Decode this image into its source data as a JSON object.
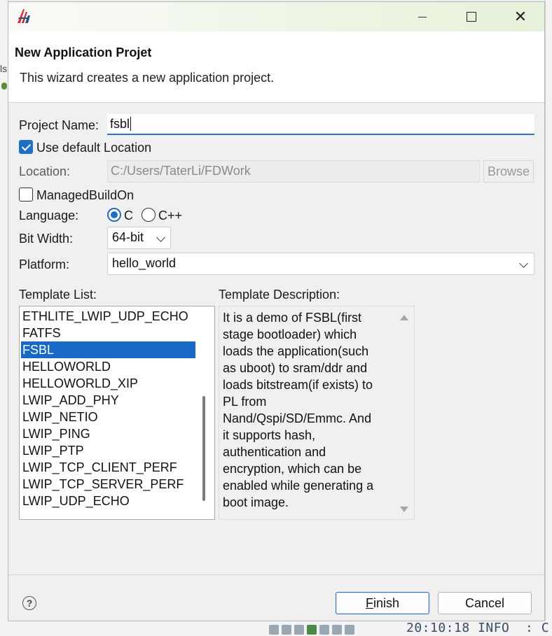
{
  "background": {
    "left_fragment": "ls",
    "log_text": "20:10:18 INFO  : C"
  },
  "dialog": {
    "title": "New Application Projet",
    "description": "This wizard creates a new application project.",
    "close_glyph": "✕"
  },
  "form": {
    "project_name_label": "Project Name:",
    "project_name_value": "fsbl",
    "use_default_location_label": "Use default Location",
    "use_default_location_checked": true,
    "location_label": "Location:",
    "location_value": "C:/Users/TaterLi/FDWork",
    "browse_label": "Browse",
    "managed_build_label": "ManagedBuildOn",
    "managed_build_checked": false,
    "language_label": "Language:",
    "language_options": [
      "C",
      "C++"
    ],
    "language_selected": "C",
    "bit_width_label": "Bit Width:",
    "bit_width_value": "64-bit",
    "platform_label": "Platform:",
    "platform_value": "hello_world"
  },
  "templates": {
    "list_label": "Template List:",
    "description_label": "Template Description:",
    "items": [
      "ETHLITE_LWIP_UDP_ECHO",
      "FATFS",
      "FSBL",
      "HELLOWORLD",
      "HELLOWORLD_XIP",
      "LWIP_ADD_PHY",
      "LWIP_NETIO",
      "LWIP_PING",
      "LWIP_PTP",
      "LWIP_TCP_CLIENT_PERF",
      "LWIP_TCP_SERVER_PERF",
      "LWIP_UDP_ECHO"
    ],
    "selected": "FSBL",
    "description_lines": [
      "It is a demo of FSBL(first",
      "stage bootloader) which",
      "loads the application(such",
      "as uboot) to sram/ddr and",
      "loads bitstream(if exists) to",
      "PL from",
      "Nand/Qspi/SD/Emmc. And",
      "it supports hash,",
      "authentication and",
      "encryption, which can be",
      "enabled while generating a",
      "boot image."
    ]
  },
  "footer": {
    "help_glyph": "?",
    "finish_mnemonic": "F",
    "finish_rest": "inish",
    "cancel_label": "Cancel"
  },
  "colors": {
    "accent": "#1f6fc5",
    "selection": "#1769c5",
    "focus_underline": "#2b74c9"
  }
}
